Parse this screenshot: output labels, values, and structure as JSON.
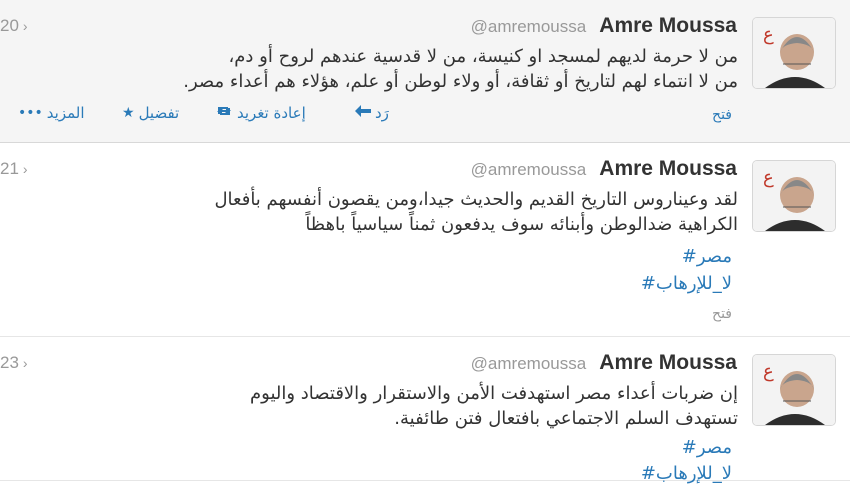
{
  "tweets": [
    {
      "name": "Amre Moussa",
      "handle": "@amremoussa",
      "time": "20",
      "lines": [
        "من لا حرمة لديهم لمسجد او كنيسة، من لا قدسية عندهم لروح أو دم،",
        "من لا انتماء لهم لتاريخ أو ثقافة، أو ولاء لوطن أو علم، هؤلاء هم أعداء مصر."
      ],
      "open_label": "فتح",
      "actions": {
        "reply": "رَد",
        "retweet": "إعادة تغريد",
        "favorite": "تفضيل",
        "more": "المزيد"
      }
    },
    {
      "name": "Amre Moussa",
      "handle": "@amremoussa",
      "time": "21",
      "lines": [
        "لقد وعيناروس التاريخ القديم والحديث جيدا،ومن يقصون أنفسهم بأفعال",
        "الكراهية ضدالوطن وأبنائه سوف يدفعون ثمناً سياسياً باهظاً"
      ],
      "hashtags": [
        "مصر#",
        "لا_للإرهاب#"
      ],
      "open_label": "فتح"
    },
    {
      "name": "Amre Moussa",
      "handle": "@amremoussa",
      "time": "23",
      "lines": [
        "إن ضربات أعداء مصر استهدفت الأمن والاستقرار والاقتصاد واليوم",
        "تستهدف السلم الاجتماعي بافتعال فتن طائفية."
      ],
      "hashtags": [
        "مصر#",
        "لا_للإرهاب#"
      ]
    }
  ],
  "icons": {
    "time_arrow": "chevron-icon",
    "reply": "reply-arrow-icon",
    "retweet": "retweet-icon",
    "favorite": "star-icon",
    "more": "dots-icon"
  },
  "colors": {
    "link": "#2a7ab8",
    "muted": "#999999",
    "highlight_bg": "#f5f5f5"
  }
}
